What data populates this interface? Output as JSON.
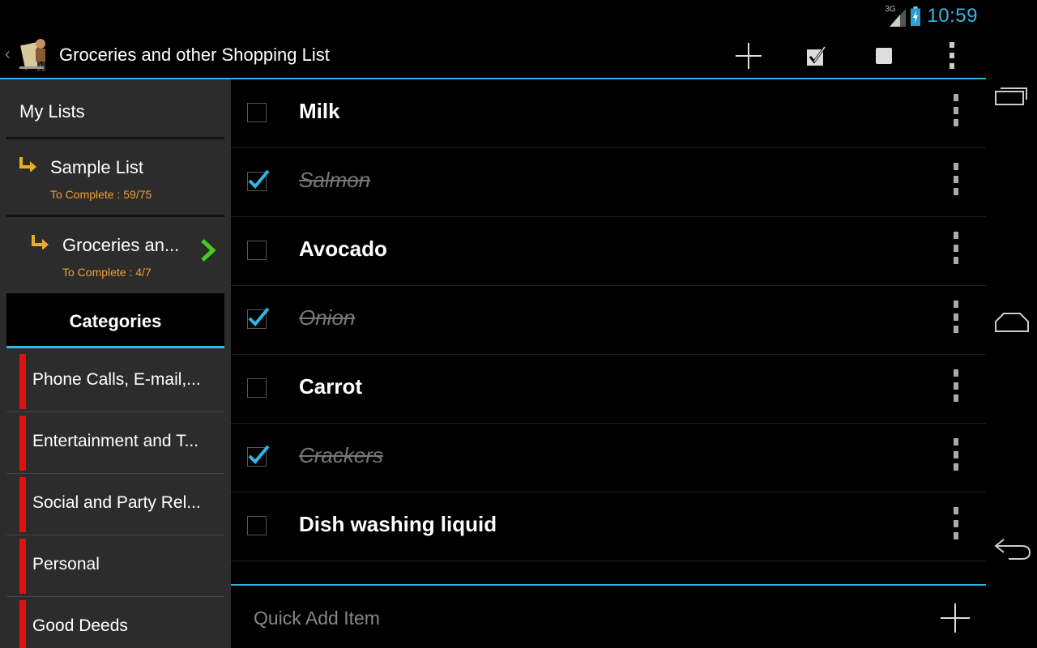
{
  "status": {
    "network": "3G",
    "time": "10:59"
  },
  "actionbar": {
    "title": "Groceries and other Shopping List",
    "icons": [
      "back-chevron-icon",
      "app-logo-icon",
      "add-icon",
      "check-all-icon",
      "uncheck-all-icon",
      "overflow-menu-icon"
    ]
  },
  "sidebar": {
    "my_lists_label": "My Lists",
    "lists": [
      {
        "name": "Sample List",
        "to_complete": "To Complete : 59/75"
      },
      {
        "name": "Groceries an...",
        "to_complete": "To Complete : 4/7"
      }
    ],
    "categories_label": "Categories",
    "categories": [
      {
        "label": "Phone Calls, E-mail,...",
        "color": "#e01010"
      },
      {
        "label": "Entertainment and T...",
        "color": "#e01010"
      },
      {
        "label": "Social and Party Rel...",
        "color": "#e01010"
      },
      {
        "label": "Personal",
        "color": "#e01010"
      },
      {
        "label": "Good Deeds",
        "color": "#e01010"
      }
    ]
  },
  "items": [
    {
      "name": "Milk",
      "checked": false
    },
    {
      "name": "Salmon",
      "checked": true
    },
    {
      "name": "Avocado",
      "checked": false
    },
    {
      "name": "Onion",
      "checked": true
    },
    {
      "name": "Carrot",
      "checked": false
    },
    {
      "name": "Crackers",
      "checked": true
    },
    {
      "name": "Dish washing liquid",
      "checked": false
    }
  ],
  "quick_add": {
    "placeholder": "Quick Add Item"
  },
  "colors": {
    "accent": "#33b5e5",
    "subtext": "#f0a030",
    "category": "#e01010",
    "selected_chevron": "#44cc22"
  }
}
